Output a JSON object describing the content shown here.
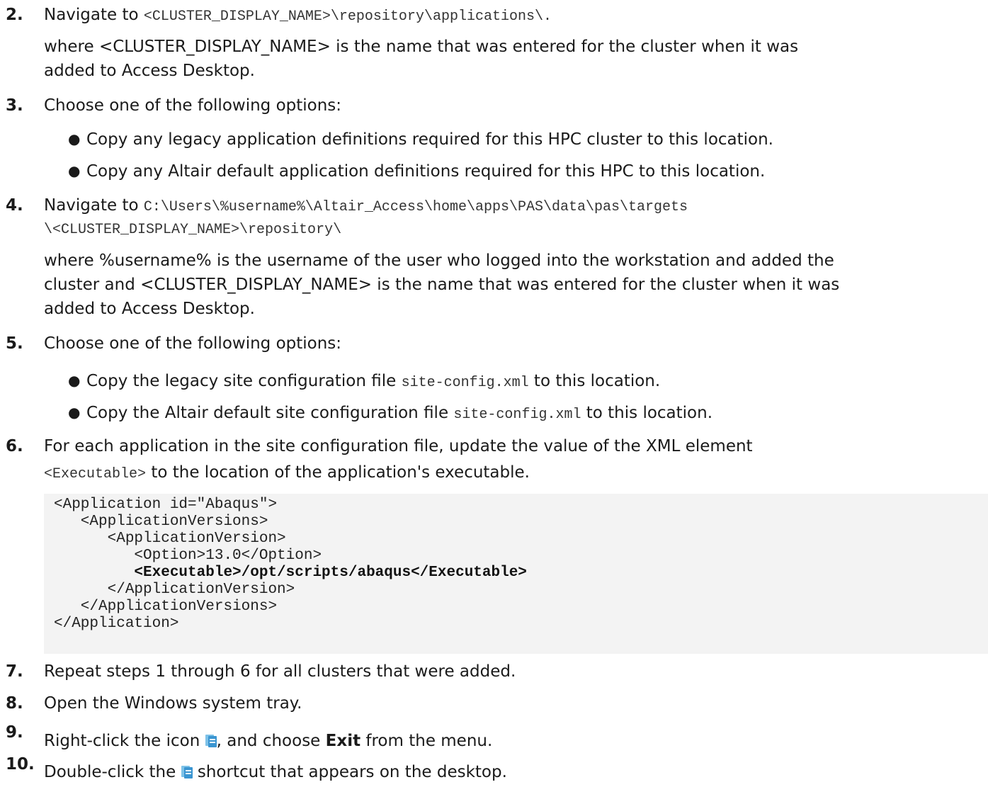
{
  "steps": [
    {
      "num": "2.",
      "intro": "Navigate to ",
      "path": "<CLUSTER_DISPLAY_NAME>\\repository\\applications\\.",
      "desc": [
        "where <CLUSTER_DISPLAY_NAME> is the name that was entered for the cluster when it was",
        "added to Access Desktop."
      ]
    },
    {
      "num": "3.",
      "text": "Choose one of the following options:",
      "bullets": [
        "Copy any legacy application definitions required for this HPC cluster to this location.",
        "Copy any Altair default application definitions required for this HPC to this location."
      ]
    },
    {
      "num": "4.",
      "intro": "Navigate to ",
      "path1": "C:\\Users\\%username%\\Altair_Access\\home\\apps\\PAS\\data\\pas\\targets",
      "path2": "\\<CLUSTER_DISPLAY_NAME>\\repository\\",
      "desc": [
        "where %username% is the username of the user who logged into the workstation and added the",
        "cluster and <CLUSTER_DISPLAY_NAME> is the name that was entered for the cluster when it was",
        "added to Access Desktop."
      ]
    },
    {
      "num": "5.",
      "text": "Choose one of the following options:",
      "bullets": [
        {
          "pre": "Copy the legacy site configuration file ",
          "code": "site-config.xml",
          "post": " to this location."
        },
        {
          "pre": "Copy the Altair default site configuration file ",
          "code": "site-config.xml",
          "post": " to this location."
        }
      ]
    },
    {
      "num": "6.",
      "line1": "For each application in the site configuration file, update the value of the XML element",
      "code": "<Executable>",
      "line2": " to the location of the application's executable."
    },
    {
      "num": "7.",
      "text": "Repeat steps 1 through 6 for all clusters that were added."
    },
    {
      "num": "8.",
      "text": "Open the Windows system tray."
    },
    {
      "num": "9.",
      "pre": "Right-click the icon ",
      "mid": ", and choose ",
      "bold": "Exit",
      "post": " from the menu."
    },
    {
      "num": "10.",
      "pre": "Double-click the ",
      "post": " shortcut that appears on the desktop."
    }
  ],
  "code_lines": [
    "<Application id=\"Abaqus\">",
    "   <ApplicationVersions>",
    "      <ApplicationVersion>",
    "         <Option>13.0</Option>",
    "         <Executable>/opt/scripts/abaqus</Executable>",
    "      </ApplicationVersion>",
    "   </ApplicationVersions>",
    "</Application>"
  ],
  "icons": {
    "app": "altair-access-icon"
  }
}
